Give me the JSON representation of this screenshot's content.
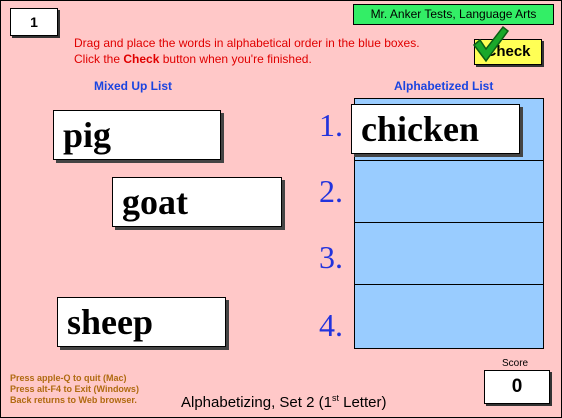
{
  "page_number": "1",
  "brand": "Mr. Anker Tests, Language Arts",
  "instructions": {
    "line1": "Drag and place the words in alphabetical order in the blue boxes.",
    "line2_prefix": "Click the ",
    "line2_keyword": "Check",
    "line2_suffix": " button when you're finished."
  },
  "check_button": {
    "label": "Check",
    "icon": "green-checkmark-icon"
  },
  "mixed_list": {
    "heading": "Mixed Up List",
    "words": [
      "pig",
      "goat",
      "sheep"
    ]
  },
  "alphabetized_list": {
    "heading": "Alphabetized List",
    "numbers": [
      "1.",
      "2.",
      "3.",
      "4."
    ],
    "placed": [
      "chicken",
      "",
      "",
      ""
    ]
  },
  "quit_info": [
    "Press apple-Q to quit (Mac)",
    "Press alt-F4 to Exit (Windows)",
    "Back returns to Web browser."
  ],
  "set_title": {
    "prefix": "Alphabetizing, Set 2 (1",
    "superscript": "st",
    "suffix": " Letter)"
  },
  "score": {
    "label": "Score",
    "value": "0"
  },
  "colors": {
    "background": "#ffc8c8",
    "slots": "#99ccff",
    "brand_bar": "#33ee66",
    "check_button": "#ffff55",
    "instruction_text": "#e00000",
    "heading_text": "#1a44e0",
    "number_text": "#2233dd"
  }
}
